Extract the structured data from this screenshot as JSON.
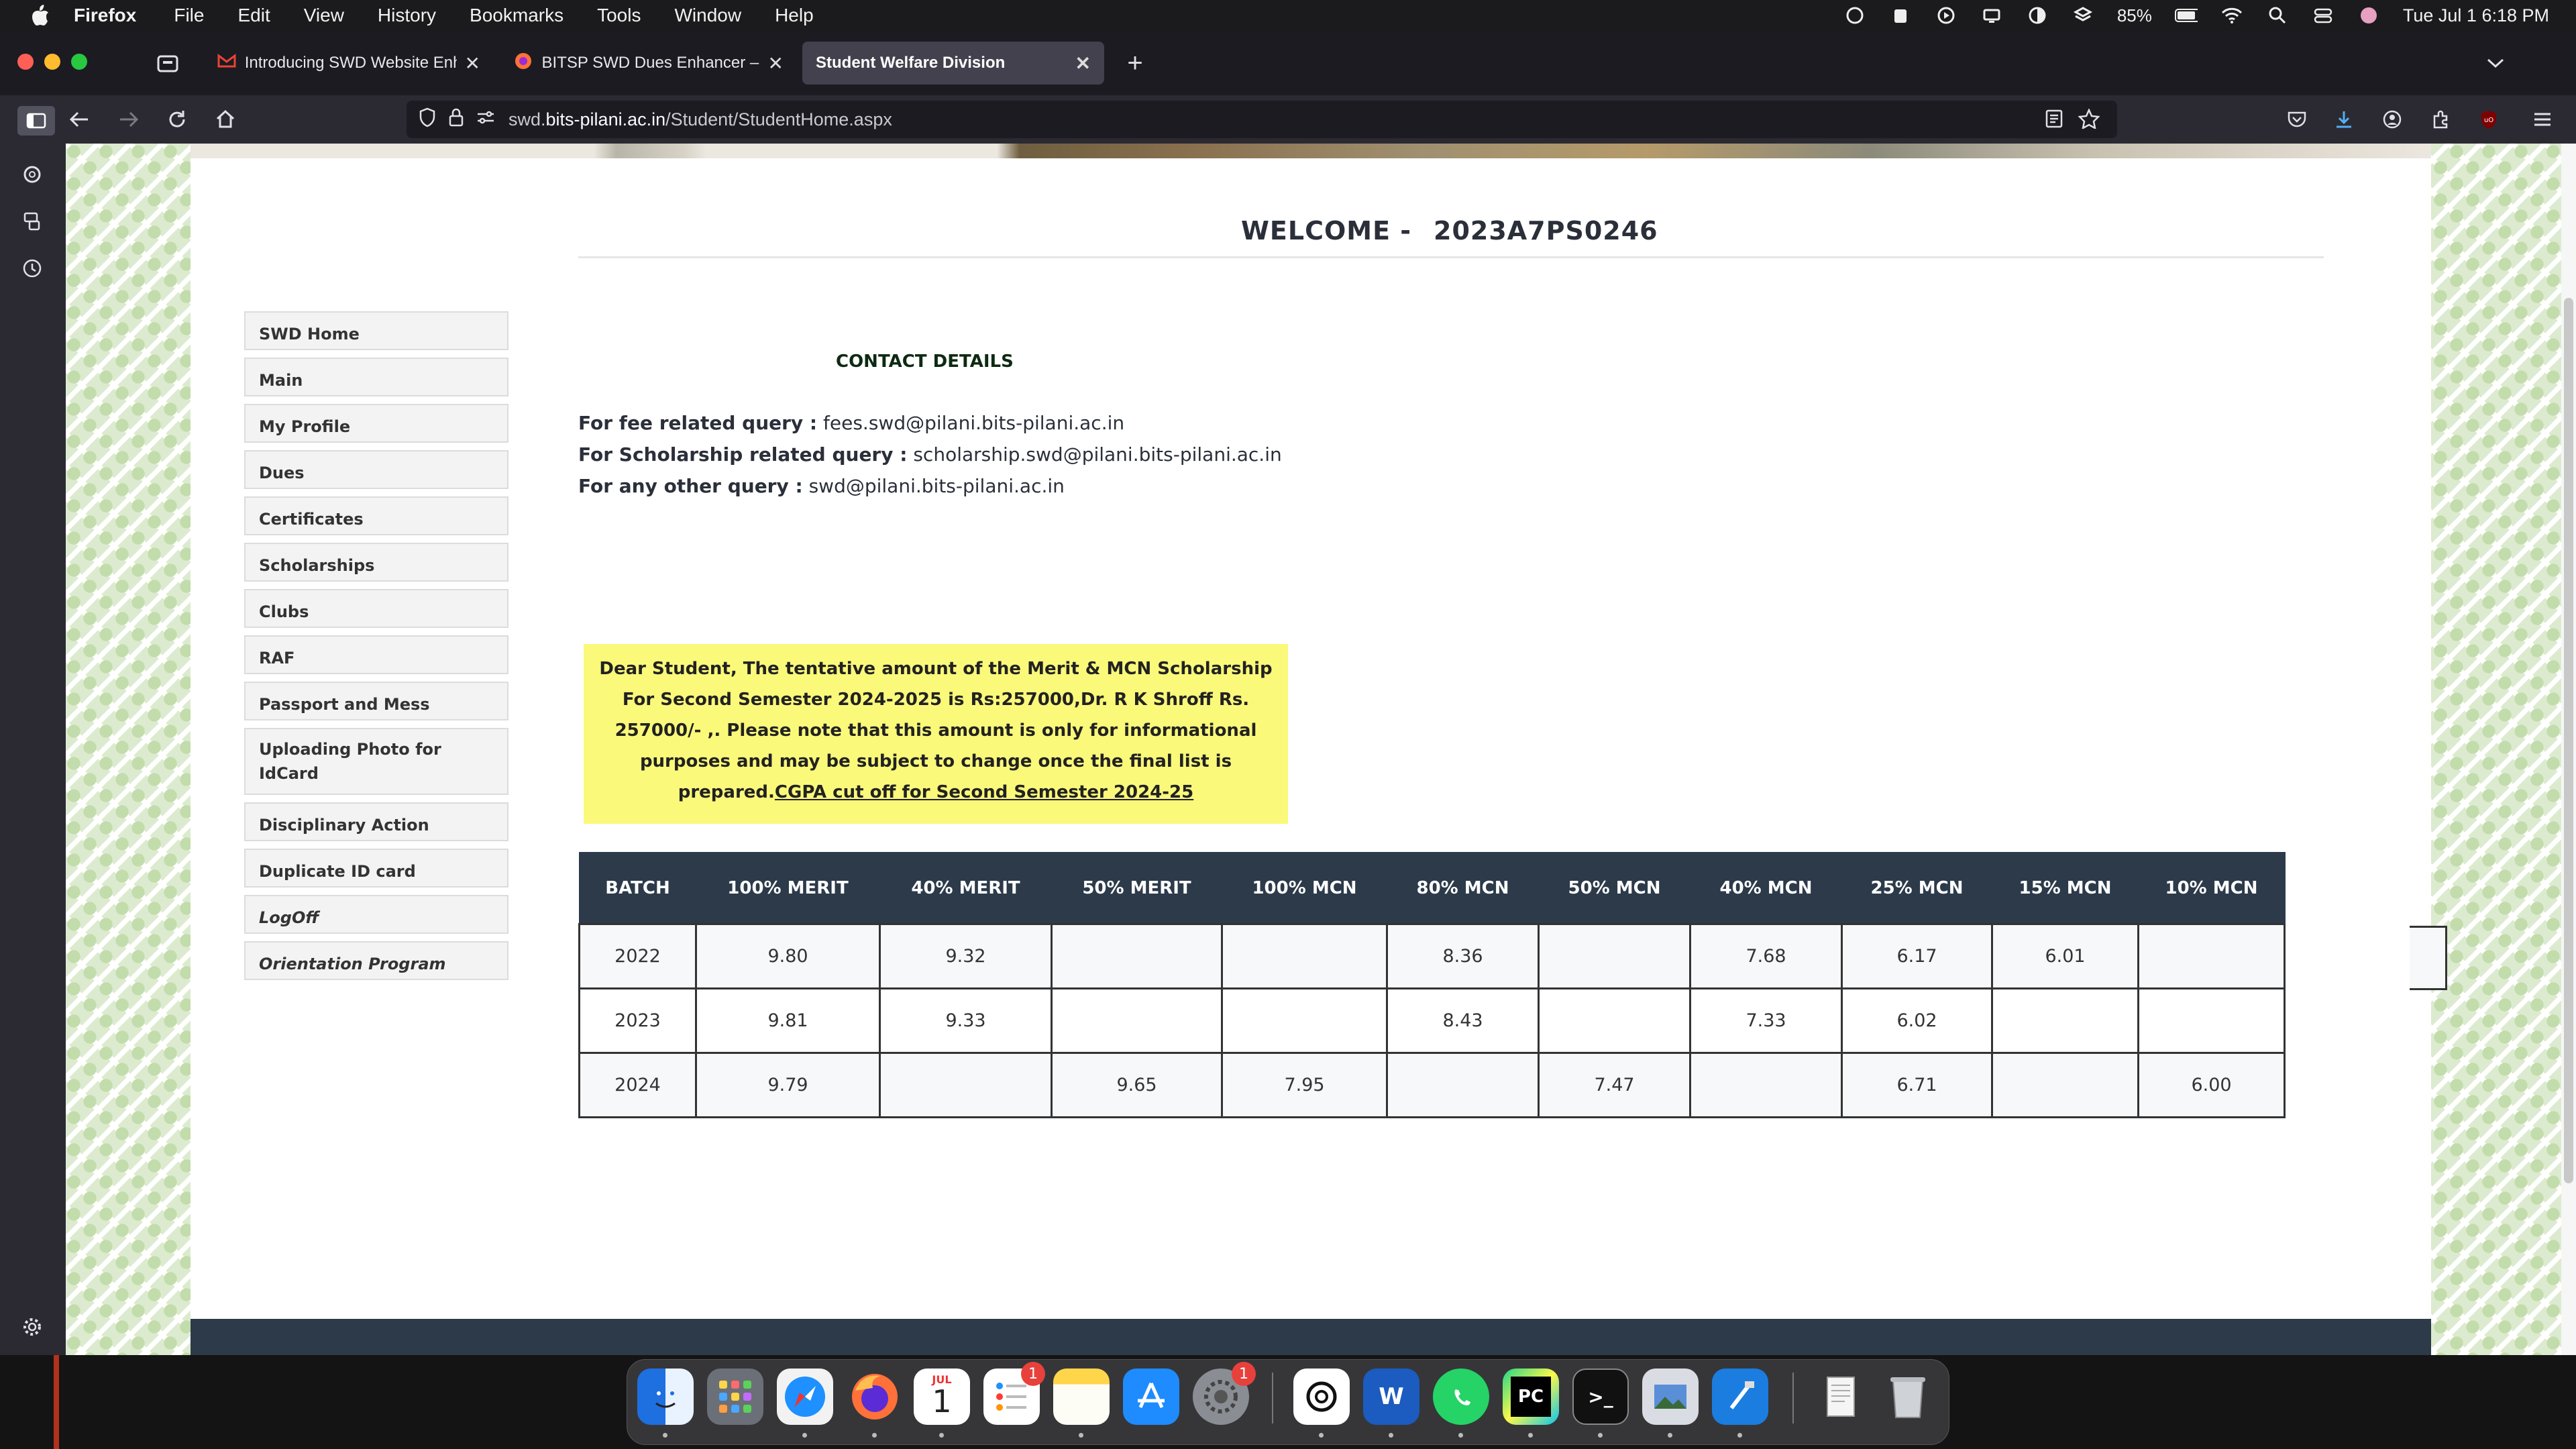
{
  "menubar": {
    "app_name": "Firefox",
    "items": [
      "File",
      "Edit",
      "View",
      "History",
      "Bookmarks",
      "Tools",
      "Window",
      "Help"
    ],
    "battery": "85%",
    "datetime": "Tue Jul 1  6:18 PM"
  },
  "tabs": [
    {
      "title": "Introducing SWD Website Enhancer",
      "icon": "gmail-icon"
    },
    {
      "title": "BITSP SWD Dues Enhancer – Get",
      "icon": "firefox-addon-icon"
    },
    {
      "title": "Student Welfare Division",
      "icon": "none"
    }
  ],
  "url": {
    "prefix": "swd.",
    "host": "bits-pilani.ac.in",
    "path": "/Student/StudentHome.aspx"
  },
  "welcome": {
    "label": "WELCOME -",
    "student_id": "2023A7PS0246"
  },
  "nav": [
    {
      "label": "SWD Home"
    },
    {
      "label": "Main"
    },
    {
      "label": "My Profile"
    },
    {
      "label": "Dues"
    },
    {
      "label": "Certificates"
    },
    {
      "label": "Scholarships"
    },
    {
      "label": "Clubs"
    },
    {
      "label": "RAF"
    },
    {
      "label": "Passport and Mess"
    },
    {
      "label": "Uploading Photo for IdCard"
    },
    {
      "label": "Disciplinary Action"
    },
    {
      "label": "Duplicate ID card"
    },
    {
      "label": "LogOff"
    },
    {
      "label": "Orientation Program"
    }
  ],
  "contact": {
    "title": "CONTACT DETAILS",
    "lines": [
      {
        "label": "For fee related query :",
        "value": " fees.swd@pilani.bits-pilani.ac.in"
      },
      {
        "label": "For Scholarship related query :",
        "value": " scholarship.swd@pilani.bits-pilani.ac.in"
      },
      {
        "label": "For any other query :",
        "value": " swd@pilani.bits-pilani.ac.in"
      }
    ]
  },
  "notice": {
    "text": "Dear Student, The tentative amount of the Merit & MCN Scholarship For Second Semester 2024-2025 is Rs:257000,Dr. R K Shroff Rs. 257000/- ,. Please note that this amount is only for informational purposes and may be subject to change once the final list is prepared.",
    "link": "CGPA cut off for Second Semester 2024-25"
  },
  "table": {
    "headers": [
      "BATCH",
      "100% MERIT",
      "40% MERIT",
      "50% MERIT",
      "100% MCN",
      "80% MCN",
      "50% MCN",
      "40% MCN",
      "25% MCN",
      "15% MCN",
      "10% MCN"
    ],
    "rows": [
      [
        "2022",
        "9.80",
        "9.32",
        "",
        "",
        "8.36",
        "",
        "7.68",
        "6.17",
        "6.01",
        ""
      ],
      [
        "2023",
        "9.81",
        "9.33",
        "",
        "",
        "8.43",
        "",
        "7.33",
        "6.02",
        "",
        ""
      ],
      [
        "2024",
        "9.79",
        "",
        "9.65",
        "7.95",
        "",
        "7.47",
        "",
        "6.71",
        "",
        "6.00"
      ]
    ]
  },
  "dock": {
    "calendar_month": "JUL",
    "calendar_day": "1",
    "reminders_badge": "1",
    "settings_badge": "1"
  },
  "colors": {
    "table_header": "#2c3a4a",
    "notice_bg": "#fbf97a",
    "page_pattern": "#dcebcf"
  }
}
